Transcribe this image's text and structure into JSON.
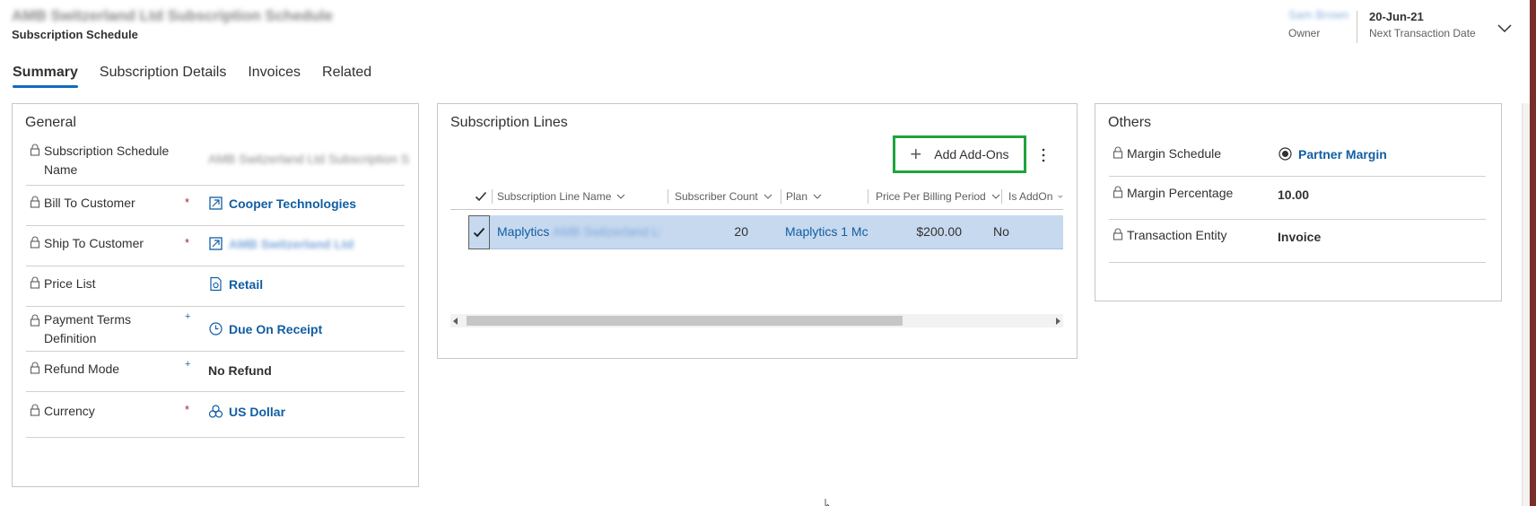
{
  "header": {
    "record_title": "AMB Switzerland Ltd Subscription Schedule",
    "entity_name": "Subscription Schedule",
    "owner_value": "Sam Brown",
    "owner_label": "Owner",
    "date_value": "20-Jun-21",
    "date_label": "Next Transaction Date"
  },
  "tabs": [
    {
      "label": "Summary",
      "active": true
    },
    {
      "label": "Subscription Details",
      "active": false
    },
    {
      "label": "Invoices",
      "active": false
    },
    {
      "label": "Related",
      "active": false
    }
  ],
  "general": {
    "title": "General",
    "fields": [
      {
        "label": "Subscription Schedule Name",
        "required": "",
        "value": "AMB Switzerland Ltd Subscription S"
      },
      {
        "label": "Bill To Customer",
        "required": "*",
        "value": "Cooper Technologies",
        "icon": "account-icon"
      },
      {
        "label": "Ship To Customer",
        "required": "*",
        "value": "AMB Switzerland Ltd",
        "icon": "account-icon"
      },
      {
        "label": "Price List",
        "required": "",
        "value": "Retail",
        "icon": "price-list-icon"
      },
      {
        "label": "Payment Terms Definition",
        "required": "+",
        "value": "Due On Receipt",
        "icon": "payment-terms-icon"
      },
      {
        "label": "Refund Mode",
        "required": "+",
        "value": "No Refund"
      },
      {
        "label": "Currency",
        "required": "*",
        "value": "US Dollar",
        "icon": "currency-icon"
      }
    ]
  },
  "subscription_lines": {
    "title": "Subscription Lines",
    "add_button_label": "Add Add-Ons",
    "columns": [
      "Subscription Line Name",
      "Subscriber Count",
      "Plan",
      "Price Per Billing Period",
      "Is AddOn"
    ],
    "rows": [
      {
        "name_prefix": "Maplytics",
        "name_suffix": "AMB Switzerland Ltd",
        "subscriber_count": "20",
        "plan": "Maplytics 1 Mc",
        "price": "$200.00",
        "is_addon": "No"
      }
    ]
  },
  "others": {
    "title": "Others",
    "fields": [
      {
        "label": "Margin Schedule",
        "value": "Partner Margin",
        "icon": "margin-icon"
      },
      {
        "label": "Margin Percentage",
        "value": "10.00"
      },
      {
        "label": "Transaction Entity",
        "value": "Invoice"
      }
    ]
  },
  "colors": {
    "accent": "#0f6cbd",
    "link": "#115ea3",
    "selection": "#c6d9ef",
    "highlight_box": "#1fa33c",
    "required": "#a4262c"
  }
}
